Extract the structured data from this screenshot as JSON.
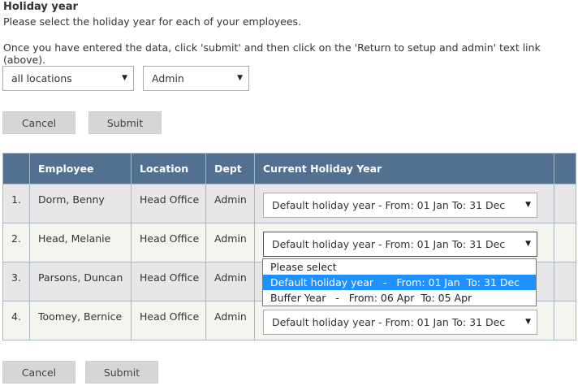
{
  "page": {
    "title": "Holiday year",
    "line1": "Please select the holiday year for each of your employees.",
    "line2": "Once you have entered the data, click 'submit' and then click on the 'Return to setup and admin' text link (above)."
  },
  "filters": {
    "location": "all locations",
    "dept": "Admin"
  },
  "buttons": {
    "cancel": "Cancel",
    "submit": "Submit"
  },
  "table": {
    "headers": [
      "",
      "Employee",
      "Location",
      "Dept",
      "Current Holiday Year",
      ""
    ],
    "rows": [
      {
        "num": "1.",
        "employee": "Dorm, Benny",
        "location": "Head Office",
        "dept": "Admin",
        "year": "Default holiday year   -   From: 01 Jan  To: 31 Dec"
      },
      {
        "num": "2.",
        "employee": "Head, Melanie",
        "location": "Head Office",
        "dept": "Admin",
        "year": "Default holiday year   -   From: 01 Jan  To: 31 Dec"
      },
      {
        "num": "3.",
        "employee": "Parsons, Duncan",
        "location": "Head Office",
        "dept": "Admin",
        "year": ""
      },
      {
        "num": "4.",
        "employee": "Toomey, Bernice",
        "location": "Head Office",
        "dept": "Admin",
        "year": "Default holiday year   -   From: 01 Jan  To: 31 Dec"
      }
    ]
  },
  "dropdown": {
    "options": [
      "Please select",
      "Default holiday year   -   From: 01 Jan  To: 31 Dec",
      "Buffer Year   -   From: 06 Apr  To: 05 Apr"
    ],
    "highlighted_index": 1
  },
  "icons": {
    "arrow": "▼"
  },
  "colors": {
    "header_bg": "#527090",
    "highlight": "#1e90ff",
    "button_bg": "#d6d6d6"
  }
}
